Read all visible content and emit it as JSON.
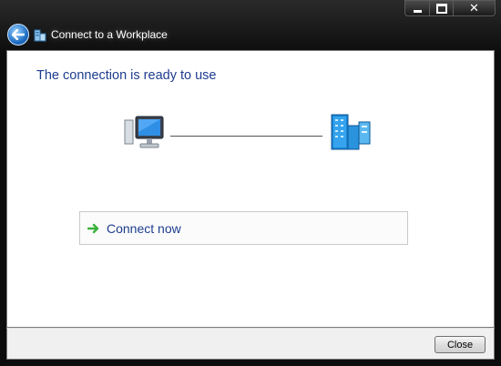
{
  "window": {
    "title": "Connect to a Workplace",
    "icons": {
      "back": "back-arrow-icon",
      "app": "connect-to-workplace-icon",
      "minimize": "minimize-icon",
      "maximize": "maximize-icon",
      "close": "close-icon"
    },
    "close_glyph": "✕"
  },
  "main": {
    "heading": "The connection is ready to use",
    "illustration": {
      "left": "computer-icon",
      "right": "workplace-server-icon"
    },
    "action": {
      "label": "Connect now",
      "icon": "green-arrow-icon"
    }
  },
  "footer": {
    "close_label": "Close"
  },
  "colors": {
    "heading": "#1e3d8f",
    "link": "#1e3d8f",
    "arrow": "#3cb23c",
    "chrome": "#0c0c0c"
  }
}
